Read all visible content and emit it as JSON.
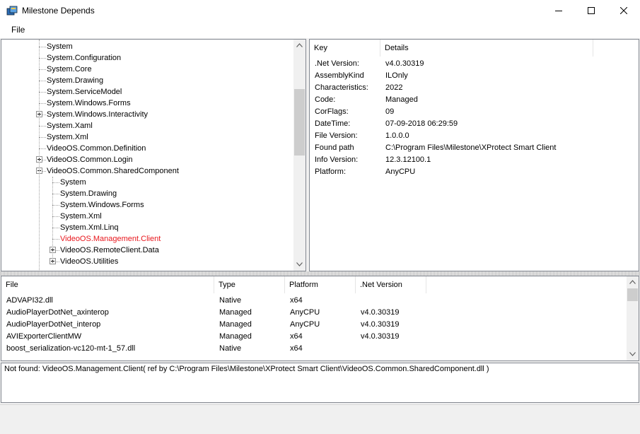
{
  "window": {
    "title": "Milestone Depends",
    "minimize_icon": "minimize-icon",
    "maximize_icon": "maximize-icon",
    "close_icon": "close-icon"
  },
  "menu": {
    "file_label": "File"
  },
  "tree": {
    "items": [
      {
        "label": "System",
        "depth": 1,
        "expander": "none",
        "color": "#000000"
      },
      {
        "label": "System.Configuration",
        "depth": 1,
        "expander": "none",
        "color": "#000000"
      },
      {
        "label": "System.Core",
        "depth": 1,
        "expander": "none",
        "color": "#000000"
      },
      {
        "label": "System.Drawing",
        "depth": 1,
        "expander": "none",
        "color": "#000000"
      },
      {
        "label": "System.ServiceModel",
        "depth": 1,
        "expander": "none",
        "color": "#000000"
      },
      {
        "label": "System.Windows.Forms",
        "depth": 1,
        "expander": "none",
        "color": "#000000"
      },
      {
        "label": "System.Windows.Interactivity",
        "depth": 1,
        "expander": "plus",
        "color": "#000000"
      },
      {
        "label": "System.Xaml",
        "depth": 1,
        "expander": "none",
        "color": "#000000"
      },
      {
        "label": "System.Xml",
        "depth": 1,
        "expander": "none",
        "color": "#000000"
      },
      {
        "label": "VideoOS.Common.Definition",
        "depth": 1,
        "expander": "none",
        "color": "#000000"
      },
      {
        "label": "VideoOS.Common.Login",
        "depth": 1,
        "expander": "plus",
        "color": "#000000"
      },
      {
        "label": "VideoOS.Common.SharedComponent",
        "depth": 1,
        "expander": "minus",
        "color": "#000000"
      },
      {
        "label": "System",
        "depth": 2,
        "expander": "none",
        "color": "#000000"
      },
      {
        "label": "System.Drawing",
        "depth": 2,
        "expander": "none",
        "color": "#000000"
      },
      {
        "label": "System.Windows.Forms",
        "depth": 2,
        "expander": "none",
        "color": "#000000"
      },
      {
        "label": "System.Xml",
        "depth": 2,
        "expander": "none",
        "color": "#000000"
      },
      {
        "label": "System.Xml.Linq",
        "depth": 2,
        "expander": "none",
        "color": "#000000"
      },
      {
        "label": "VideoOS.Management.Client",
        "depth": 2,
        "expander": "none",
        "color": "#e8171d"
      },
      {
        "label": "VideoOS.RemoteClient.Data",
        "depth": 2,
        "expander": "plus",
        "color": "#000000"
      },
      {
        "label": "VideoOS.Utilities",
        "depth": 2,
        "expander": "plus",
        "color": "#000000"
      }
    ]
  },
  "details": {
    "headers": {
      "key": "Key",
      "details": "Details"
    },
    "rows": [
      {
        "key": ".Net Version:",
        "value": "v4.0.30319"
      },
      {
        "key": "AssemblyKind",
        "value": "ILOnly"
      },
      {
        "key": "Characteristics:",
        "value": "2022"
      },
      {
        "key": "Code:",
        "value": "Managed"
      },
      {
        "key": "CorFlags:",
        "value": "09"
      },
      {
        "key": "DateTime:",
        "value": "07-09-2018 06:29:59"
      },
      {
        "key": "File Version:",
        "value": "1.0.0.0"
      },
      {
        "key": "Found path",
        "value": "C:\\Program Files\\Milestone\\XProtect Smart Client"
      },
      {
        "key": "Info Version:",
        "value": "12.3.12100.1"
      },
      {
        "key": "Platform:",
        "value": "AnyCPU"
      }
    ]
  },
  "files": {
    "headers": {
      "file": "File",
      "type": "Type",
      "platform": "Platform",
      "net_version": ".Net Version"
    },
    "rows": [
      {
        "file": "ADVAPI32.dll",
        "type": "Native",
        "platform": "x64",
        "net": ""
      },
      {
        "file": "AudioPlayerDotNet_axinterop",
        "type": "Managed",
        "platform": "AnyCPU",
        "net": "v4.0.30319"
      },
      {
        "file": "AudioPlayerDotNet_interop",
        "type": "Managed",
        "platform": "AnyCPU",
        "net": "v4.0.30319"
      },
      {
        "file": "AVIExporterClientMW",
        "type": "Managed",
        "platform": "x64",
        "net": "v4.0.30319"
      },
      {
        "file": "boost_serialization-vc120-mt-1_57.dll",
        "type": "Native",
        "platform": "x64",
        "net": ""
      }
    ]
  },
  "log": {
    "message": "Not found: VideoOS.Management.Client( ref by C:\\Program Files\\Milestone\\XProtect Smart Client\\VideoOS.Common.SharedComponent.dll )"
  },
  "colors": {
    "missing_item": "#e8171d",
    "panel_border": "#828790",
    "chrome_bg": "#f0f0f0"
  }
}
